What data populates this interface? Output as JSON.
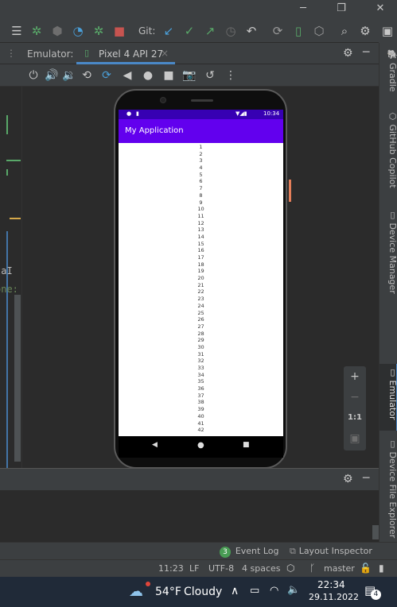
{
  "ide": {
    "git_label": "Git:",
    "emulator_label": "Emulator:",
    "device_tab": "Pixel 4 API 27",
    "device_tab_close": "×",
    "right_tabs": [
      "Gradle",
      "GitHub Copilot",
      "Device Manager",
      "Emulator",
      "Device File Explorer"
    ],
    "zoom": {
      "plus": "+",
      "minus": "−",
      "one_to_one": "1:1"
    },
    "editor_fragments": [
      "taI",
      "one:"
    ],
    "event_log": {
      "badge": "3",
      "label": "Event Log"
    },
    "layout_inspector": "Layout Inspector",
    "status": {
      "position": "11:23",
      "line_sep": "LF",
      "encoding": "UTF-8",
      "indent": "4 spaces",
      "branch": "master"
    }
  },
  "phone": {
    "status_time": "10:34",
    "app_title": "My Application",
    "list_items": [
      "1",
      "2",
      "3",
      "4",
      "5",
      "6",
      "7",
      "8",
      "9",
      "10",
      "11",
      "12",
      "13",
      "14",
      "15",
      "16",
      "17",
      "18",
      "19",
      "20",
      "21",
      "22",
      "23",
      "24",
      "25",
      "26",
      "27",
      "28",
      "29",
      "30",
      "31",
      "32",
      "33",
      "34",
      "35",
      "36",
      "37",
      "38",
      "39",
      "40",
      "41",
      "42"
    ]
  },
  "taskbar": {
    "weather_temp": "54°F",
    "weather_desc": "Cloudy",
    "time": "22:34",
    "date": "29.11.2022",
    "notif_count": "4"
  },
  "colors": {
    "app_bar": "#6200ee",
    "status_bar": "#3700b3",
    "ide_bg": "#2b2b2b",
    "ide_panel": "#3c3f41"
  }
}
